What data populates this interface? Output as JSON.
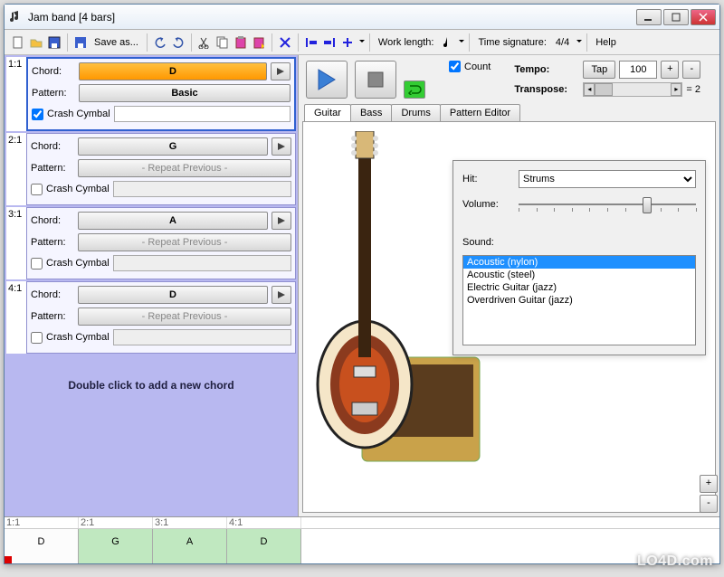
{
  "window": {
    "title": "Jam band [4 bars]"
  },
  "toolbar": {
    "save_as": "Save as...",
    "work_length_label": "Work length:",
    "time_sig_label": "Time signature:",
    "time_sig_value": "4/4",
    "help": "Help"
  },
  "bars": [
    {
      "num": "1:1",
      "chord": "D",
      "pattern": "Basic",
      "pattern_disabled": false,
      "selected": true,
      "crash": true
    },
    {
      "num": "2:1",
      "chord": "G",
      "pattern": "- Repeat Previous -",
      "pattern_disabled": true,
      "selected": false,
      "crash": false
    },
    {
      "num": "3:1",
      "chord": "A",
      "pattern": "- Repeat Previous -",
      "pattern_disabled": true,
      "selected": false,
      "crash": false
    },
    {
      "num": "4:1",
      "chord": "D",
      "pattern": "- Repeat Previous -",
      "pattern_disabled": true,
      "selected": false,
      "crash": false
    }
  ],
  "card_labels": {
    "chord": "Chord:",
    "pattern": "Pattern:",
    "crash": "Crash Cymbal"
  },
  "add_hint": "Double click to add a new chord",
  "controls": {
    "count_label": "Count",
    "count_checked": true,
    "tempo_label": "Tempo:",
    "tap_label": "Tap",
    "tempo_value": "100",
    "transpose_label": "Transpose:",
    "transpose_value": "= 2"
  },
  "tabs": [
    "Guitar",
    "Bass",
    "Drums",
    "Pattern Editor"
  ],
  "active_tab": 0,
  "guitar_panel": {
    "hit_label": "Hit:",
    "hit_value": "Strums",
    "volume_label": "Volume:",
    "sound_label": "Sound:",
    "sounds": [
      "Acoustic (nylon)",
      "Acoustic (steel)",
      "Electric Guitar (jazz)",
      "Overdriven Guitar (jazz)"
    ],
    "sound_selected": 0
  },
  "timeline": {
    "ticks": [
      "1:1",
      "2:1",
      "3:1",
      "4:1"
    ],
    "bars": [
      {
        "label": "D",
        "cls": "w"
      },
      {
        "label": "G",
        "cls": "g"
      },
      {
        "label": "A",
        "cls": "g"
      },
      {
        "label": "D",
        "cls": "g"
      }
    ]
  },
  "watermark": "LO4D.com"
}
